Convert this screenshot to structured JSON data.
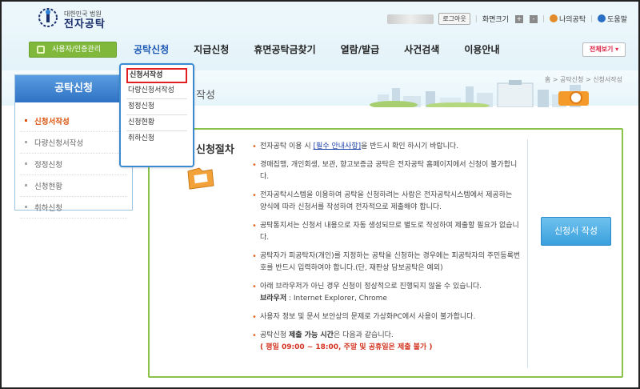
{
  "header": {
    "logo_sub": "대한민국 법원",
    "logo_main": "전자공탁",
    "logout": "로그아웃",
    "font_size_label": "화면크기",
    "zoom_in": "+",
    "zoom_out": "-",
    "my_page": "나의공탁",
    "help": "도움말",
    "auth_button": "사용자/인증관리",
    "all_view": "전체보기",
    "menu": [
      "공탁신청",
      "지급신청",
      "휴면공탁금찾기",
      "열람/발급",
      "사건검색",
      "이용안내"
    ]
  },
  "breadcrumb": "홈 > 공탁신청 > 신청서작성",
  "page_title_fragment": "작성",
  "dropdown": {
    "items": [
      "신청서작성",
      "다량신청서작성",
      "정정신청",
      "신청현황",
      "취하신청"
    ]
  },
  "lnb": {
    "title": "공탁신청",
    "items": [
      "신청서작성",
      "다량신청서작성",
      "정정신청",
      "신청현황",
      "취하신청"
    ]
  },
  "main": {
    "step_title": "신청절차",
    "notes": [
      {
        "pre": "전자공탁 이용 시 ",
        "link": "[필수 안내사항]",
        "post": "을 반드시 확인 하시기 바랍니다."
      },
      {
        "text": "경매집행, 개인회생, 보관, 향고보증금 공탁은 전자공탁 홈페이지에서 신청이 불가합니다."
      },
      {
        "text": "전자공탁시스템을 이용하여 공탁을 신청하려는 사람은 전자공탁시스템에서 제공하는 양식에 따라 신청서를 작성하여 전자적으로 제출해야 합니다."
      },
      {
        "text": "공탁통지서는 신청서 내용으로 자동 생성되므로 별도로 작성하여 제출할 필요가 없습니다."
      },
      {
        "text": "공탁자가 피공탁자(개인)를 지정하는 공탁을 신청하는 경우에는 피공탁자의 주민등록번호를 반드시 입력하여야 합니다.(단, 재판상 담보공탁은 예외)"
      },
      {
        "text": "아래 브라우저가 아닌 경우 신청이 정상적으로 진행되지 않을 수 있습니다.",
        "browser_label": "브라우저",
        "browser_value": " : Internet Explorer, Chrome"
      },
      {
        "text": "사용자 정보 및 문서 보안상의 문제로 가상화PC에서 사용이 불가합니다."
      },
      {
        "pre": "공탁신청 ",
        "bold": "제출 가능 시간",
        "post": "은 다음과 같습니다.",
        "hours": "( 평일 09:00 ~ 18:00, 주말 및 공휴일은 제출 불가 )"
      }
    ],
    "apply_button": "신청서 작성"
  }
}
